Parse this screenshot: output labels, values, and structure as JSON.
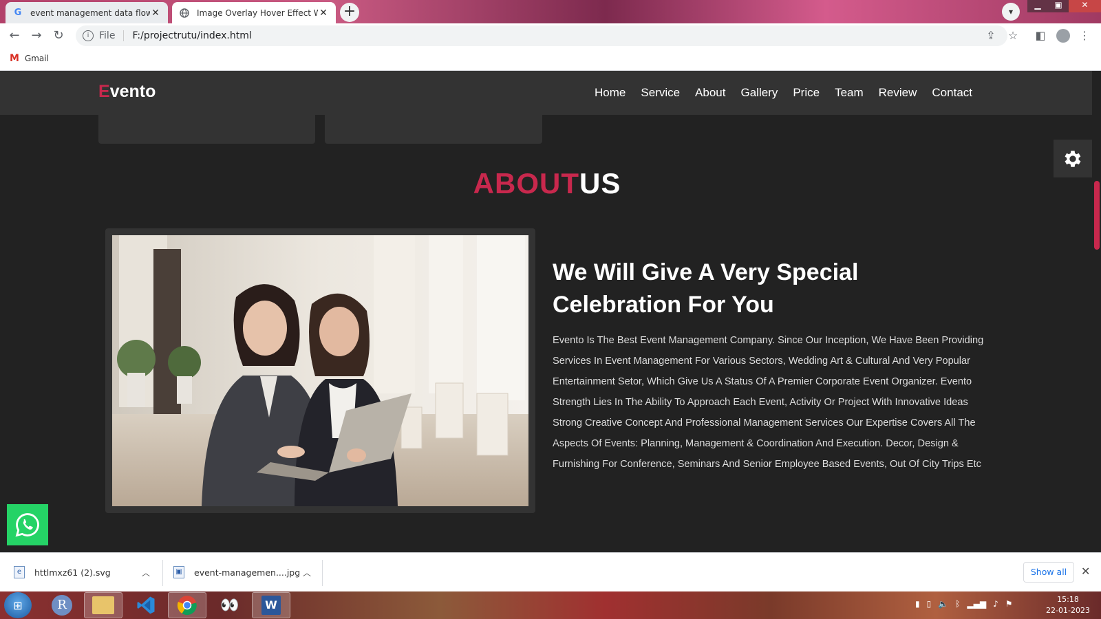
{
  "browser": {
    "tabs": [
      {
        "title": "event management data flow dia",
        "favicon": "G",
        "active": false
      },
      {
        "title": "Image Overlay Hover Effect With",
        "favicon": "globe",
        "active": true
      }
    ],
    "address": {
      "scheme_label": "File",
      "url": "F:/projectrutu/index.html"
    },
    "bookmarks": [
      {
        "label": "Gmail"
      }
    ]
  },
  "site": {
    "logo_first": "E",
    "logo_rest": "vento",
    "nav": [
      "Home",
      "Service",
      "About",
      "Gallery",
      "Price",
      "Team",
      "Review",
      "Contact"
    ],
    "about_title_a": "ABOUT",
    "about_title_b": "US",
    "heading": "We Will Give A Very Special Celebration For You",
    "paragraph": "Evento Is The Best Event Management Company. Since Our Inception, We Have Been Providing Services In Event Management For Various Sectors, Wedding Art & Cultural And Very Popular Entertainment Setor, Which Give Us A Status Of A Premier Corporate Event Organizer. Evento Strength Lies In The Ability To Approach Each Event, Activity Or Project With Innovative Ideas Strong Creative Concept And Professional Management Services Our Expertise Covers All The Aspects Of Events: Planning, Management & Coordination And Execution. Decor, Design & Furnishing For Conference, Seminars And Senior Employee Based Events, Out Of City Trips Etc",
    "accent_color": "#c8284d"
  },
  "downloads": {
    "items": [
      {
        "name": "httlmxz61 (2).svg"
      },
      {
        "name": "event-managemen....jpg"
      }
    ],
    "show_all": "Show all"
  },
  "taskbar": {
    "time": "15:18",
    "date": "22-01-2023"
  }
}
